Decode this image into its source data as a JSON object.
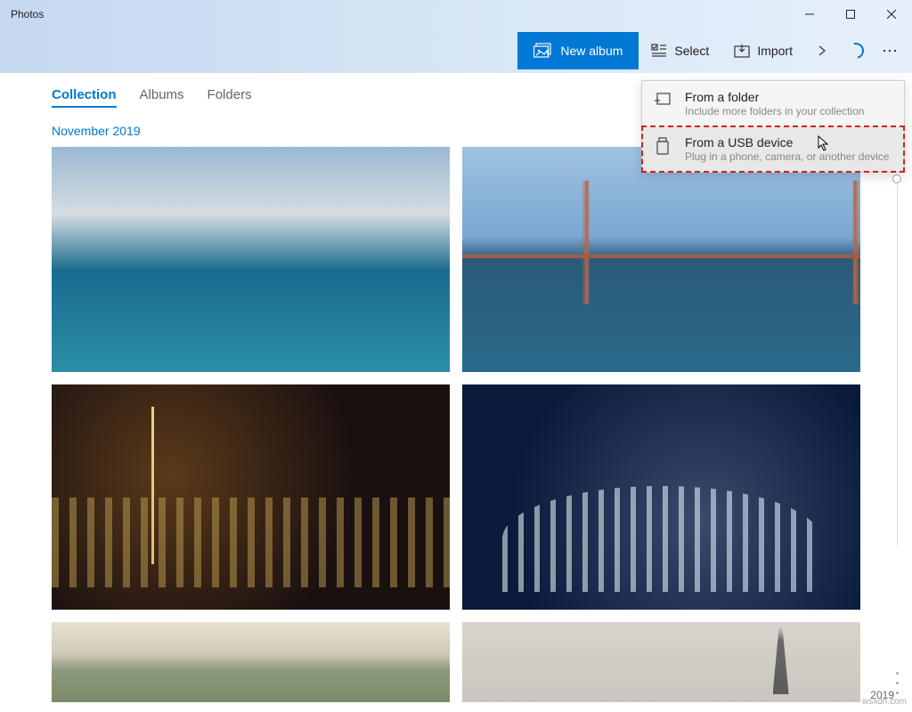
{
  "app": {
    "title": "Photos"
  },
  "toolbar": {
    "new_album": "New album",
    "select": "Select",
    "import": "Import"
  },
  "tabs": {
    "collection": "Collection",
    "albums": "Albums",
    "folders": "Folders"
  },
  "date_group": "November 2019",
  "import_menu": {
    "folder": {
      "title": "From a folder",
      "subtitle": "Include more folders in your collection"
    },
    "usb": {
      "title": "From a USB device",
      "subtitle": "Plug in a phone, camera, or another device"
    }
  },
  "timeline": {
    "year": "2019"
  },
  "watermark": "wsxdn.com"
}
